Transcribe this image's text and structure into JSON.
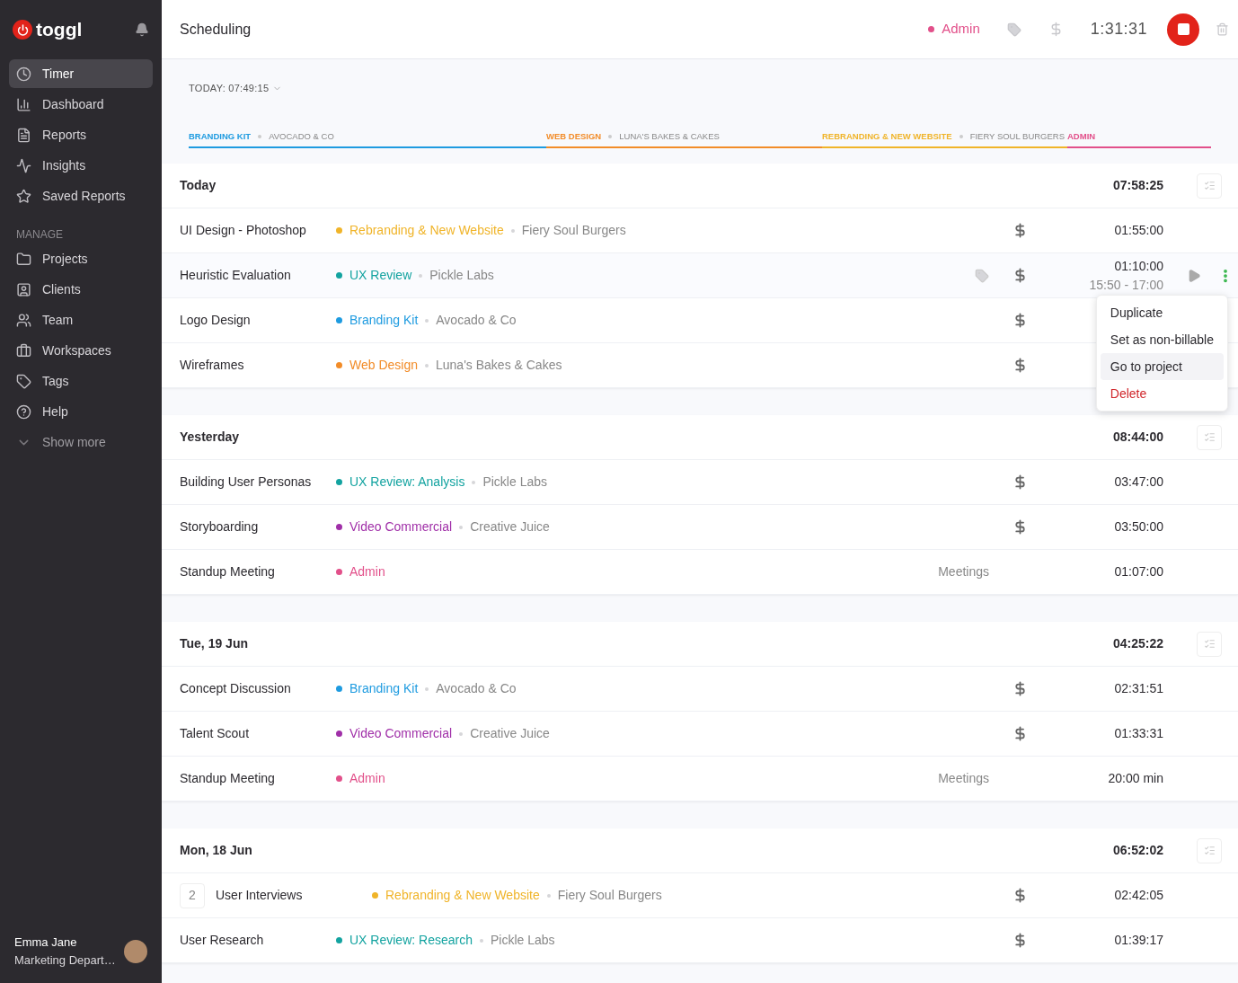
{
  "sidebar": {
    "logo": "toggl",
    "items": [
      {
        "label": "Timer",
        "selected": true
      },
      {
        "label": "Dashboard",
        "selected": false
      },
      {
        "label": "Reports",
        "selected": false
      },
      {
        "label": "Insights",
        "selected": false
      },
      {
        "label": "Saved Reports",
        "selected": false
      }
    ],
    "section_label": "MANAGE",
    "manage_items": [
      {
        "label": "Projects",
        "selected": false
      },
      {
        "label": "Clients",
        "selected": false
      },
      {
        "label": "Team",
        "selected": false
      },
      {
        "label": "Workspaces",
        "selected": false
      },
      {
        "label": "Tags",
        "selected": false
      },
      {
        "label": "Help",
        "selected": false
      },
      {
        "label": "Show more",
        "selected": false
      }
    ],
    "user": {
      "name": "Emma Jane",
      "department": "Marketing Depart…"
    }
  },
  "header": {
    "title": "Scheduling",
    "running": {
      "project": "Admin",
      "color": "#e2508a",
      "duration": "1:31:31"
    }
  },
  "summary": {
    "today": "TODAY: 07:49:15",
    "segments": [
      {
        "project": "BRANDING KIT",
        "client": "AVOCADO & CO",
        "color": "#1e9be0"
      },
      {
        "project": "WEB DESIGN",
        "client": "LUNA'S BAKES & CAKES",
        "color": "#f28c28"
      },
      {
        "project": "REBRANDING & NEW WEBSITE",
        "client": "FIERY SOUL BURGERS",
        "color": "#f0b429"
      },
      {
        "project": "ADMIN",
        "color": "#e2508a"
      }
    ]
  },
  "groups": [
    {
      "date": "Today",
      "total": "07:58:25",
      "entries": [
        {
          "description": "UI Design - Photoshop",
          "project": "Rebranding & New Website",
          "color": "#f0b429",
          "client": "Fiery Soul Burgers",
          "billable": true,
          "duration": "01:55:00",
          "hovered": false
        },
        {
          "description": "Heuristic Evaluation",
          "project": "UX Review",
          "color": "#13a3a0",
          "client": "Pickle Labs",
          "billable": true,
          "duration": "01:10:00",
          "range": "15:50 - 17:00",
          "hovered": true
        },
        {
          "description": "Logo Design",
          "project": "Branding Kit",
          "color": "#1e9be0",
          "client": "Avocado & Co",
          "billable": true,
          "hovered": false
        },
        {
          "description": "Wireframes",
          "project": "Web Design",
          "color": "#f28c28",
          "client": "Luna's Bakes & Cakes",
          "billable": true,
          "hovered": false
        }
      ]
    },
    {
      "date": "Yesterday",
      "total": "08:44:00",
      "entries": [
        {
          "description": "Building User Personas",
          "project": "UX Review: Analysis",
          "color": "#13a3a0",
          "client": "Pickle Labs",
          "billable": true,
          "duration": "03:47:00",
          "hovered": false
        },
        {
          "description": "Storyboarding",
          "project": "Video Commercial",
          "color": "#a02fa8",
          "client": "Creative Juice",
          "billable": true,
          "duration": "03:50:00",
          "hovered": false
        },
        {
          "description": "Standup Meeting",
          "project": "Admin",
          "color": "#e2508a",
          "billable": false,
          "tag": "Meetings",
          "duration": "01:07:00",
          "hovered": false
        }
      ]
    },
    {
      "date": "Tue, 19 Jun",
      "total": "04:25:22",
      "entries": [
        {
          "description": "Concept Discussion",
          "project": "Branding Kit",
          "color": "#1e9be0",
          "client": "Avocado & Co",
          "billable": true,
          "duration": "02:31:51",
          "hovered": false
        },
        {
          "description": "Talent Scout",
          "project": "Video Commercial",
          "color": "#a02fa8",
          "client": "Creative Juice",
          "billable": true,
          "duration": "01:33:31",
          "hovered": false
        },
        {
          "description": "Standup Meeting",
          "project": "Admin",
          "color": "#e2508a",
          "billable": false,
          "tag": "Meetings",
          "duration": "20:00 min",
          "hovered": false
        }
      ]
    },
    {
      "date": "Mon, 18 Jun",
      "total": "06:52:02",
      "entries": [
        {
          "count": "2",
          "description": "User Interviews",
          "project": "Rebranding & New Website",
          "color": "#f0b429",
          "client": "Fiery Soul Burgers",
          "billable": true,
          "duration": "02:42:05",
          "hovered": false
        },
        {
          "description": "User Research",
          "project": "UX Review: Research",
          "color": "#13a3a0",
          "client": "Pickle Labs",
          "billable": true,
          "duration": "01:39:17",
          "hovered": false
        }
      ]
    }
  ],
  "context_menu": {
    "items": [
      {
        "label": "Duplicate",
        "kind": "normal",
        "selected": false
      },
      {
        "label": "Set as non-billable",
        "kind": "normal",
        "selected": false
      },
      {
        "label": "Go to project",
        "kind": "normal",
        "selected": true
      },
      {
        "label": "Delete",
        "kind": "danger",
        "selected": false
      }
    ]
  }
}
